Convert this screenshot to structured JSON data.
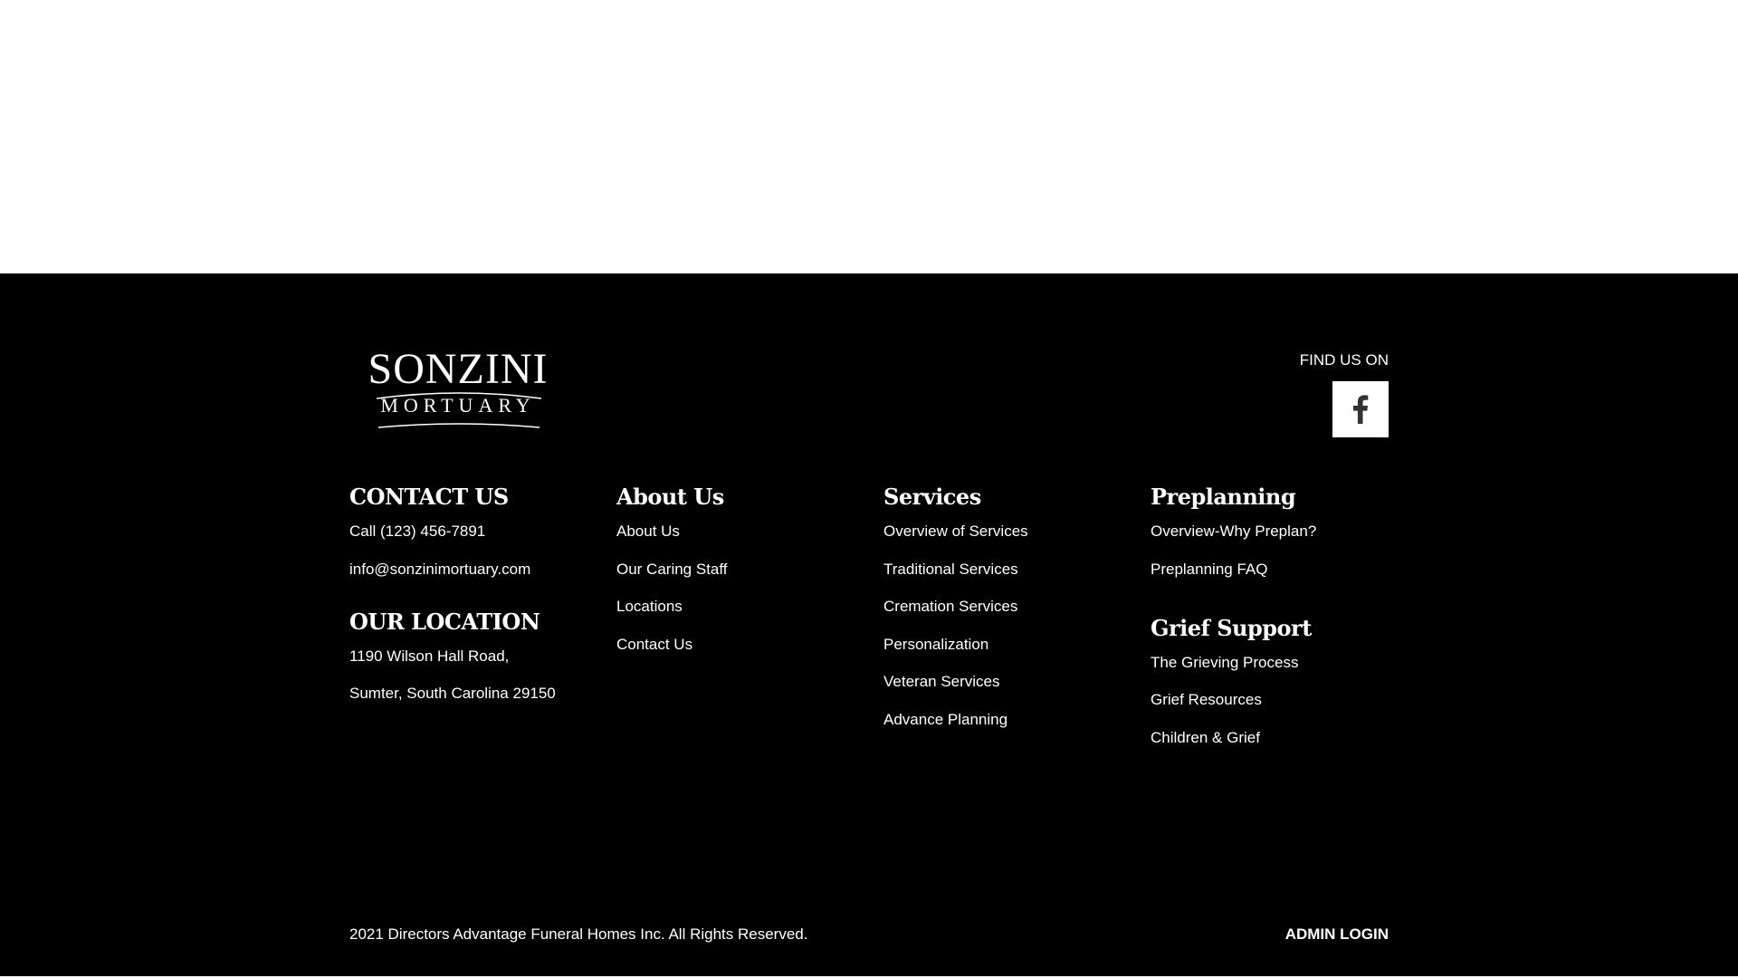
{
  "colors": {
    "footer_background": "#000000",
    "text": "#ffffff",
    "page_background": "#ffffff"
  },
  "logo": {
    "name": "SONZINI",
    "subtitle": "MORTUARY"
  },
  "social": {
    "find_us_label": "FIND US ON",
    "facebook_icon": "facebook-icon"
  },
  "contact": {
    "heading": "CONTACT US",
    "phone": "Call (123) 456-7891",
    "email": "info@sonzinimortuary.com"
  },
  "location": {
    "heading": "OUR LOCATION",
    "address_line1": "1190 Wilson Hall Road,",
    "address_line2": "Sumter, South Carolina 29150"
  },
  "about": {
    "heading": "About Us",
    "links": [
      "About Us",
      "Our Caring Staff",
      "Locations",
      "Contact Us"
    ]
  },
  "services": {
    "heading": "Services",
    "links": [
      "Overview of Services",
      "Traditional Services",
      "Cremation Services",
      "Personalization",
      "Veteran Services",
      "Advance Planning"
    ]
  },
  "preplanning": {
    "heading": "Preplanning",
    "links": [
      "Overview-Why Preplan?",
      "Preplanning FAQ"
    ]
  },
  "grief": {
    "heading": "Grief Support",
    "links": [
      "The Grieving Process",
      "Grief Resources",
      "Children & Grief"
    ]
  },
  "bottom": {
    "copyright": "2021 Directors Advantage Funeral Homes Inc. All Rights Reserved.",
    "admin_login": "ADMIN LOGIN"
  }
}
